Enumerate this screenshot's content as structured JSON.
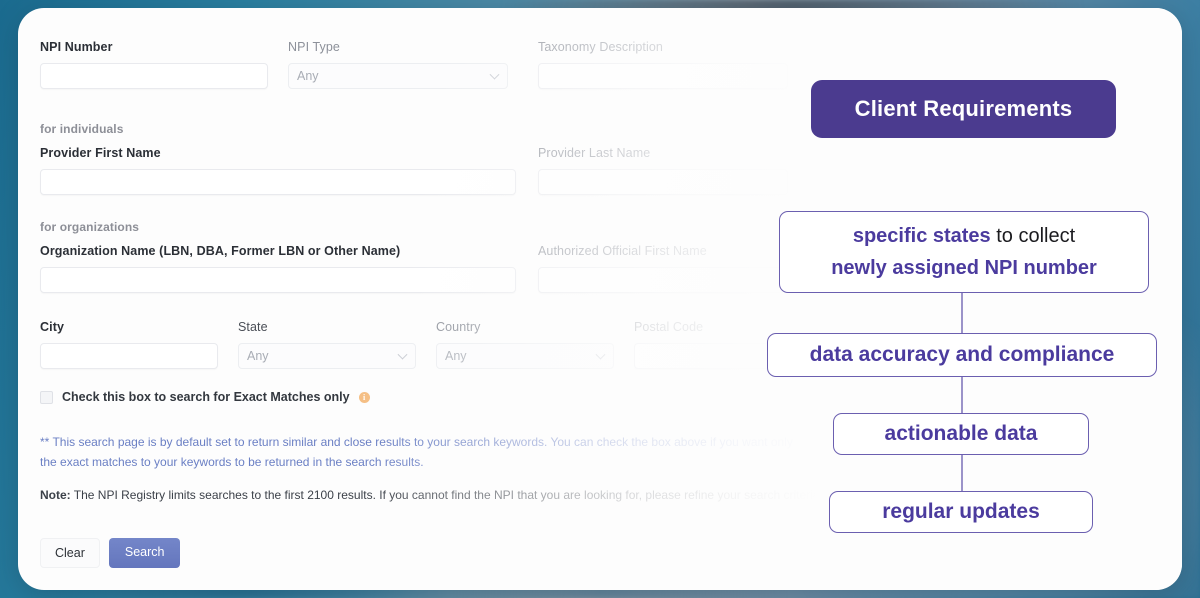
{
  "form": {
    "fields": {
      "npi_number_label": "NPI Number",
      "npi_type_label": "NPI Type",
      "npi_type_value": "Any",
      "taxonomy_label": "Taxonomy Description",
      "section_individuals": "for individuals",
      "provider_first_label": "Provider First Name",
      "provider_last_label": "Provider Last Name",
      "section_organizations": "for organizations",
      "organization_label": "Organization Name (LBN, DBA, Former LBN or Other Name)",
      "authorized_official_label": "Authorized Official First Name",
      "city_label": "City",
      "state_label": "State",
      "state_value": "Any",
      "country_label": "Country",
      "country_value": "Any",
      "postal_label": "Postal Code"
    },
    "checkbox_label": "Check this box to search for Exact Matches only",
    "disclaimer_1": "** This search page is by default set to return similar and close results to your search keywords. You can check the box above if you want only the exact matches to your keywords to be returned in the search results.",
    "disclaimer_note_prefix": "Note:",
    "disclaimer_2": " The NPI Registry limits searches to the first 2100 results. If you cannot find the NPI that you are looking for, please refine your search criteria.",
    "clear_button": "Clear",
    "search_button": "Search"
  },
  "diagram": {
    "badge": "Client Requirements",
    "node1_line1_strong": "specific states",
    "node1_line1_plain": " to collect",
    "node1_line2": "newly assigned NPI number",
    "node2": "data accuracy and compliance",
    "node3": "actionable data",
    "node4": "regular updates"
  },
  "colors": {
    "badge_purple": "#4b3b8f",
    "node_border": "#6b5fb0",
    "node_text": "#4b3b9e",
    "connector": "#9b93c9",
    "search_button": "#6476bd",
    "disclaimer_blue": "#6a7fc4",
    "info_icon_orange": "#f5bf85",
    "backdrop_teal": "#2a7fa0"
  }
}
